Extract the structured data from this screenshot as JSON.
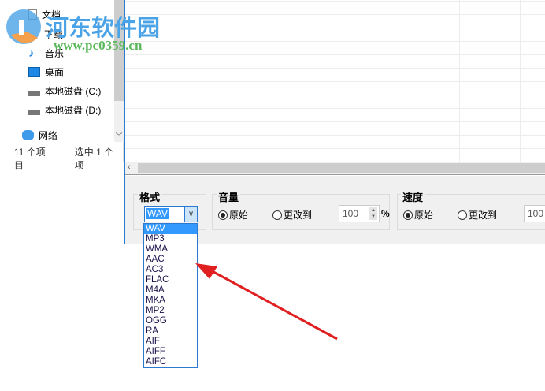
{
  "explorer": {
    "items": [
      {
        "label": "文档",
        "icon": "document-icon"
      },
      {
        "label": "下载",
        "icon": "download-icon"
      },
      {
        "label": "音乐",
        "icon": "music-icon"
      },
      {
        "label": "桌面",
        "icon": "desktop-icon"
      },
      {
        "label": "本地磁盘 (C:)",
        "icon": "drive-c-icon"
      },
      {
        "label": "本地磁盘 (D:)",
        "icon": "drive-icon"
      }
    ],
    "network": "网络",
    "status_count": "11 个项目",
    "status_selected": "选中 1 个项"
  },
  "panel": {
    "format": {
      "title": "格式",
      "value": "WAV",
      "options": [
        "WAV",
        "MP3",
        "WMA",
        "AAC",
        "AC3",
        "FLAC",
        "M4A",
        "MKA",
        "MP2",
        "OGG",
        "RA",
        "AIF",
        "AIFF",
        "AIFC"
      ],
      "selected": "WAV"
    },
    "volume": {
      "title": "音量",
      "original": "原始",
      "change": "更改到",
      "value": "100",
      "unit": "%",
      "selected": "原始"
    },
    "speed": {
      "title": "速度",
      "original": "原始",
      "change": "更改到",
      "value": "100",
      "selected": "原始"
    }
  },
  "watermark": {
    "name": "河东软件园",
    "url": "www.pc0359.cn"
  },
  "colors": {
    "accent": "#2b79d0",
    "selection": "#3399ff",
    "arrow": "#e02020"
  }
}
